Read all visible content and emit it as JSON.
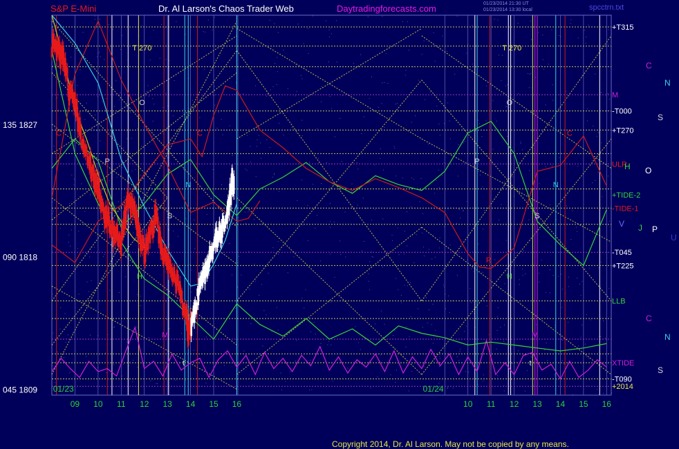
{
  "header": {
    "instrument": "S&P E-Mini",
    "title": "Dr. Al Larson's Chaos Trader Web",
    "site": "Daytradingforecasts.com",
    "stamp1": "01/23/2014 21:30 UT",
    "stamp2": "01/23/2014 13:30 local",
    "file": "spcctrn.txt"
  },
  "footer": {
    "copyright": "Copyright 2014, Dr. Al Larson. May not be copied by any means."
  },
  "colors": {
    "background": "#00005a",
    "grid": "#6a6acc",
    "fib_lines": "#e6e64a",
    "price_up": "#ffffff",
    "price_down": "#e61a1a",
    "xtide": "#d020d8",
    "green_band": "#3ad23a",
    "red_band": "#cc1a1a",
    "cyan_curve": "#3ad2e6",
    "yellow_curve": "#c8c81a"
  },
  "price_axis": [
    {
      "label": "135  1827",
      "price": 1827
    },
    {
      "label": "090  1818",
      "price": 1818
    },
    {
      "label": "045  1809",
      "price": 1809
    }
  ],
  "date_labels": [
    {
      "text": "01/23",
      "hour": 8.5
    },
    {
      "text": "01/24",
      "hour": 24.5
    }
  ],
  "hour_labels": [
    {
      "text": "09",
      "hour": 9
    },
    {
      "text": "10",
      "hour": 10
    },
    {
      "text": "11",
      "hour": 11
    },
    {
      "text": "12",
      "hour": 12
    },
    {
      "text": "13",
      "hour": 13
    },
    {
      "text": "14",
      "hour": 14
    },
    {
      "text": "15",
      "hour": 15
    },
    {
      "text": "16",
      "hour": 16
    },
    {
      "text": "10",
      "hour": 26
    },
    {
      "text": "11",
      "hour": 27
    },
    {
      "text": "12",
      "hour": 28
    },
    {
      "text": "13",
      "hour": 29
    },
    {
      "text": "14",
      "hour": 30
    },
    {
      "text": "15",
      "hour": 31
    },
    {
      "text": "16",
      "hour": 32
    }
  ],
  "right_labels": [
    {
      "text": "+T315",
      "price": 1833.6,
      "color": "#ffffff"
    },
    {
      "text": "M",
      "price": 1829.0,
      "color": "#d020d8"
    },
    {
      "text": "-T000",
      "price": 1827.9,
      "color": "#ffffff"
    },
    {
      "text": "+T270",
      "price": 1826.6,
      "color": "#ffffff"
    },
    {
      "text": "ULR",
      "price": 1824.3,
      "color": "#e61a1a"
    },
    {
      "text": "+TIDE-2",
      "price": 1822.2,
      "color": "#3ad23a"
    },
    {
      "text": "-TIDE-1",
      "price": 1821.3,
      "color": "#e61a1a"
    },
    {
      "text": "-T045",
      "price": 1818.3,
      "color": "#ffffff"
    },
    {
      "text": "+T225",
      "price": 1817.4,
      "color": "#ffffff"
    },
    {
      "text": "LLB",
      "price": 1815.0,
      "color": "#3ad23a"
    },
    {
      "text": "XTIDE",
      "price": 1810.8,
      "color": "#d020d8"
    },
    {
      "text": "-T090",
      "price": 1809.7,
      "color": "#ffffff"
    },
    {
      "text": "+2014",
      "price": 1809.2,
      "color": "#e6e64a"
    }
  ],
  "chart_markers": [
    {
      "text": "T  270",
      "hour": 11.9,
      "price": 1832.2,
      "color": "#e6e64a"
    },
    {
      "text": "T  270",
      "hour": 27.9,
      "price": 1832.2,
      "color": "#e6e64a"
    },
    {
      "text": "O",
      "hour": 11.9,
      "price": 1828.5,
      "color": "#d8d8d8"
    },
    {
      "text": "O",
      "hour": 27.8,
      "price": 1828.5,
      "color": "#d8d8d8"
    },
    {
      "text": "P",
      "hour": 10.4,
      "price": 1824.5,
      "color": "#d8d8d8"
    },
    {
      "text": "P",
      "hour": 26.4,
      "price": 1824.5,
      "color": "#d8d8d8"
    },
    {
      "text": "C",
      "hour": 8.3,
      "price": 1826.4,
      "color": "#e61a1a"
    },
    {
      "text": "C",
      "hour": 14.4,
      "price": 1826.4,
      "color": "#e61a1a"
    },
    {
      "text": "C",
      "hour": 30.4,
      "price": 1826.4,
      "color": "#e61a1a"
    },
    {
      "text": "N",
      "hour": 13.9,
      "price": 1822.9,
      "color": "#3ad2e6"
    },
    {
      "text": "N",
      "hour": 29.8,
      "price": 1822.9,
      "color": "#3ad2e6"
    },
    {
      "text": "S",
      "hour": 13.1,
      "price": 1820.8,
      "color": "#d8d8d8"
    },
    {
      "text": "S",
      "hour": 29.0,
      "price": 1820.8,
      "color": "#d8d8d8"
    },
    {
      "text": "H",
      "hour": 11.8,
      "price": 1816.7,
      "color": "#3ad23a"
    },
    {
      "text": "H",
      "hour": 27.8,
      "price": 1816.7,
      "color": "#3ad23a"
    },
    {
      "text": "M",
      "hour": 12.9,
      "price": 1812.7,
      "color": "#d020d8"
    },
    {
      "text": "M",
      "hour": 28.9,
      "price": 1812.7,
      "color": "#d020d8"
    },
    {
      "text": "R",
      "hour": 26.9,
      "price": 1817.8,
      "color": "#e61a1a"
    },
    {
      "text": "t",
      "hour": 13.7,
      "price": 1810.8,
      "color": "#d8d8d8"
    },
    {
      "text": "t",
      "hour": 28.7,
      "price": 1810.8,
      "color": "#d8d8d8"
    }
  ],
  "far_right_glyphs": [
    {
      "text": "C",
      "x": 934,
      "y": 99,
      "color": "#d020d8"
    },
    {
      "text": "N",
      "x": 961,
      "y": 124,
      "color": "#3ad2e6"
    },
    {
      "text": "S",
      "x": 951,
      "y": 174,
      "color": "#d8d8d8"
    },
    {
      "text": "H",
      "x": 903,
      "y": 245,
      "color": "#3ad23a"
    },
    {
      "text": "O",
      "x": 933,
      "y": 251,
      "color": "#ffffff"
    },
    {
      "text": "V",
      "x": 895,
      "y": 328,
      "color": "#6a6aff"
    },
    {
      "text": "J",
      "x": 923,
      "y": 334,
      "color": "#3ad23a"
    },
    {
      "text": "P",
      "x": 943,
      "y": 336,
      "color": "#ffffff"
    },
    {
      "text": "U",
      "x": 970,
      "y": 348,
      "color": "#3a3acc"
    },
    {
      "text": "C",
      "x": 934,
      "y": 465,
      "color": "#d020d8"
    },
    {
      "text": "N",
      "x": 961,
      "y": 492,
      "color": "#3ad2e6"
    },
    {
      "text": "S",
      "x": 951,
      "y": 540,
      "color": "#d8d8d8"
    }
  ],
  "vertical_lines": [
    {
      "hour": 8.2,
      "color": "#cc1a1a"
    },
    {
      "hour": 10.4,
      "color": "#cc1a1a"
    },
    {
      "hour": 10.6,
      "color": "#ffffff"
    },
    {
      "hour": 11.3,
      "color": "#ffffff"
    },
    {
      "hour": 11.75,
      "color": "#e6e64a"
    },
    {
      "hour": 12.85,
      "color": "#cc1a1a"
    },
    {
      "hour": 13.05,
      "color": "#ffffff"
    },
    {
      "hour": 13.75,
      "color": "#3ad2e6"
    },
    {
      "hour": 13.9,
      "color": "#3ad2e6"
    },
    {
      "hour": 14.3,
      "color": "#cc1a1a"
    },
    {
      "hour": 16.0,
      "color": "#3ad2e6"
    },
    {
      "hour": 26.3,
      "color": "#ffffff"
    },
    {
      "hour": 26.4,
      "color": "#3ad2e6"
    },
    {
      "hour": 26.95,
      "color": "#cc1a1a"
    },
    {
      "hour": 27.75,
      "color": "#ffffff"
    },
    {
      "hour": 27.85,
      "color": "#ffffff"
    },
    {
      "hour": 28.8,
      "color": "#e6e64a"
    },
    {
      "hour": 28.9,
      "color": "#d020d8"
    },
    {
      "hour": 29.0,
      "color": "#d020d8"
    },
    {
      "hour": 29.8,
      "color": "#3ad2e6"
    },
    {
      "hour": 30.2,
      "color": "#cc1a1a"
    },
    {
      "hour": 31.7,
      "color": "#ffffff"
    }
  ],
  "chart_data": {
    "type": "line",
    "x_unit": "hour",
    "xlim": [
      8.0,
      32.2
    ],
    "ylim": [
      1808.6,
      1834.4
    ],
    "grid": true,
    "series": [
      {
        "kind": "price",
        "x": [
          8.0,
          8.25,
          8.5,
          8.75,
          9.0,
          9.25,
          9.5,
          9.75,
          10.0,
          10.25,
          10.5,
          10.75,
          11.0,
          11.25,
          11.5,
          11.75,
          12.0,
          12.25,
          12.5,
          12.75,
          13.0,
          13.25,
          13.5,
          13.75,
          13.9,
          14.1,
          14.3,
          14.5,
          14.75,
          15.0,
          15.25,
          15.5,
          15.75,
          15.9
        ],
        "y": [
          1832.4,
          1832.0,
          1831.4,
          1829.2,
          1828.6,
          1826.2,
          1825.0,
          1823.5,
          1822.6,
          1821.0,
          1820.4,
          1819.5,
          1818.9,
          1821.6,
          1821.4,
          1820.0,
          1818.2,
          1819.4,
          1820.8,
          1818.6,
          1817.3,
          1816.9,
          1815.8,
          1814.2,
          1813.0,
          1814.0,
          1815.2,
          1816.4,
          1817.7,
          1818.6,
          1819.6,
          1820.6,
          1822.5,
          1823.5
        ]
      },
      {
        "kind": "xtide",
        "x": [
          8.0,
          8.4,
          8.8,
          9.2,
          9.6,
          10.0,
          10.4,
          10.8,
          11.2,
          11.6,
          12.0,
          12.4,
          12.8,
          13.2,
          13.6,
          14.0,
          14.4,
          14.8,
          15.2,
          15.6,
          16.0,
          16.4,
          16.8,
          17.2,
          17.6,
          18.0,
          18.4,
          18.8,
          19.2,
          19.6,
          20.0,
          20.4,
          20.8,
          21.2,
          21.6,
          22.0,
          22.4,
          22.8,
          23.2,
          23.6,
          24.0,
          24.4,
          24.8,
          25.2,
          25.6,
          26.0,
          26.4,
          26.8,
          27.2,
          27.6,
          28.0,
          28.4,
          28.8,
          29.2,
          29.6,
          30.0,
          30.4,
          30.8,
          31.2,
          31.6,
          32.0
        ],
        "y": [
          1810.2,
          1811.1,
          1810.4,
          1809.8,
          1810.9,
          1810.2,
          1810.4,
          1809.9,
          1811.6,
          1813.2,
          1810.4,
          1810.9,
          1809.9,
          1811.4,
          1810.3,
          1810.8,
          1811.1,
          1809.8,
          1811.0,
          1811.6,
          1810.5,
          1811.3,
          1810.0,
          1811.5,
          1810.4,
          1811.1,
          1810.2,
          1811.3,
          1810.6,
          1811.9,
          1810.3,
          1811.2,
          1810.1,
          1811.0,
          1810.5,
          1811.4,
          1810.2,
          1811.6,
          1810.1,
          1811.2,
          1810.4,
          1811.7,
          1810.6,
          1811.4,
          1810.0,
          1811.2,
          1810.2,
          1812.3,
          1810.0,
          1810.8,
          1810.0,
          1811.3,
          1811.5,
          1810.3,
          1810.7,
          1809.7,
          1810.9,
          1809.8,
          1810.3,
          1811.0,
          1810.5
        ]
      },
      {
        "kind": "green_band_upper",
        "x": [
          8.0,
          9.0,
          10.0,
          11.0,
          12.0,
          13.0,
          14.0,
          15.0,
          16.0,
          17.0,
          18.0,
          19.0,
          20.0,
          21.0,
          22.0,
          23.0,
          24.0,
          25.0,
          26.0,
          27.0,
          28.0,
          29.0,
          30.0,
          31.0,
          32.0
        ],
        "y": [
          1824.0,
          1826.0,
          1824.5,
          1820.0,
          1821.6,
          1823.6,
          1824.6,
          1822.2,
          1820.8,
          1822.6,
          1823.4,
          1824.4,
          1823.1,
          1822.3,
          1823.5,
          1822.9,
          1822.5,
          1823.8,
          1826.4,
          1827.2,
          1825.0,
          1820.4,
          1818.8,
          1817.4,
          1821.2
        ]
      },
      {
        "kind": "green_band_lower",
        "x": [
          8.0,
          9.0,
          10.0,
          11.0,
          12.0,
          13.0,
          14.0,
          15.0,
          16.0,
          17.0,
          18.0,
          19.0,
          20.0,
          21.0,
          22.0,
          23.0,
          24.0,
          25.0,
          26.0,
          27.0,
          28.0,
          29.0,
          30.0,
          31.0,
          32.0
        ],
        "y": [
          1832.0,
          1825.0,
          1821.6,
          1819.0,
          1816.5,
          1815.4,
          1813.9,
          1812.4,
          1814.8,
          1813.4,
          1812.6,
          1813.8,
          1812.4,
          1813.1,
          1812.0,
          1813.3,
          1812.8,
          1812.5,
          1812.0,
          1812.2,
          1812.0,
          1811.8,
          1811.6,
          1811.8,
          1812.1
        ]
      },
      {
        "kind": "red_band",
        "x": [
          8.0,
          9.0,
          10.0,
          11.0,
          12.0,
          13.0,
          14.0,
          14.5,
          15.0,
          15.5,
          16.0,
          17.0,
          18.0,
          19.0,
          20.0,
          21.0,
          22.0,
          23.0,
          24.0,
          25.0,
          26.0,
          26.5,
          27.0,
          28.0,
          29.0,
          30.0,
          31.0,
          32.0
        ],
        "y": [
          1818.8,
          1817.6,
          1820.4,
          1821.5,
          1823.6,
          1825.6,
          1826.0,
          1824.8,
          1827.6,
          1829.6,
          1829.3,
          1826.6,
          1825.4,
          1824.0,
          1823.1,
          1822.5,
          1823.3,
          1822.7,
          1822.0,
          1821.0,
          1818.2,
          1817.3,
          1817.2,
          1818.6,
          1823.8,
          1824.2,
          1826.2,
          1822.8
        ]
      },
      {
        "kind": "red_band_2",
        "x": [
          8.0,
          9.0,
          10.0,
          11.0,
          12.0,
          13.0,
          14.0,
          15.0,
          16.0,
          16.5,
          17.0
        ],
        "y": [
          1822.0,
          1830.4,
          1834.0,
          1830.0,
          1827.0,
          1824.2,
          1821.0,
          1821.7,
          1820.4,
          1820.6,
          1821.8
        ]
      },
      {
        "kind": "cyan_curve",
        "x": [
          8.0,
          9.0,
          10.0,
          11.0,
          12.0,
          13.0,
          14.0,
          14.5,
          15.0,
          15.5,
          16.0
        ],
        "y": [
          1834.4,
          1832.5,
          1829.8,
          1824.6,
          1821.4,
          1818.5,
          1816.0,
          1816.2,
          1817.5,
          1819.1,
          1821.6
        ]
      },
      {
        "kind": "yellow_curve",
        "x": [
          8.0,
          8.5,
          9.0,
          9.5,
          10.0,
          10.5,
          11.0,
          11.5,
          12.0
        ],
        "y": [
          1834.4,
          1831.5,
          1828.0,
          1826.0,
          1823.6,
          1821.6,
          1820.4,
          1819.3,
          1818.6
        ]
      }
    ],
    "fib_levels": [
      1833.6,
      1832.3,
      1830.9,
      1829.0,
      1827.9,
      1826.6,
      1825.0,
      1824.3,
      1822.6,
      1821.3,
      1820.2,
      1818.3,
      1817.4,
      1815.0,
      1813.8,
      1812.4,
      1811.4,
      1810.8,
      1809.7,
      1809.2
    ],
    "fib_diagonals": [
      [
        8.0,
        1830.5,
        13.0,
        1822.0
      ],
      [
        8.0,
        1834.0,
        16.0,
        1820.0
      ],
      [
        8.0,
        1827.0,
        16.0,
        1817.5
      ],
      [
        8.0,
        1822.0,
        16.0,
        1812.0
      ],
      [
        8.0,
        1816.0,
        16.0,
        1809.0
      ],
      [
        8.0,
        1810.0,
        16.0,
        1834.0
      ],
      [
        8.0,
        1815.0,
        16.0,
        1832.0
      ],
      [
        8.0,
        1820.5,
        16.0,
        1830.5
      ],
      [
        8.0,
        1825.0,
        16.0,
        1833.0
      ],
      [
        8.0,
        1812.0,
        13.0,
        1822.0
      ],
      [
        16.0,
        1832.0,
        24.0,
        1815.0
      ],
      [
        16.0,
        1822.0,
        24.0,
        1810.0
      ],
      [
        16.0,
        1815.0,
        24.0,
        1830.0
      ],
      [
        16.0,
        1810.0,
        24.0,
        1820.0
      ],
      [
        24.0,
        1830.0,
        32.2,
        1815.0
      ],
      [
        24.0,
        1820.0,
        32.2,
        1810.0
      ],
      [
        24.0,
        1815.0,
        32.2,
        1833.0
      ],
      [
        24.0,
        1810.0,
        32.2,
        1826.0
      ],
      [
        24.0,
        1826.0,
        32.2,
        1819.0
      ],
      [
        24.0,
        1833.0,
        32.2,
        1824.0
      ],
      [
        16.0,
        1826.0,
        24.0,
        1833.5
      ],
      [
        16.0,
        1833.5,
        24.0,
        1826.0
      ]
    ]
  }
}
